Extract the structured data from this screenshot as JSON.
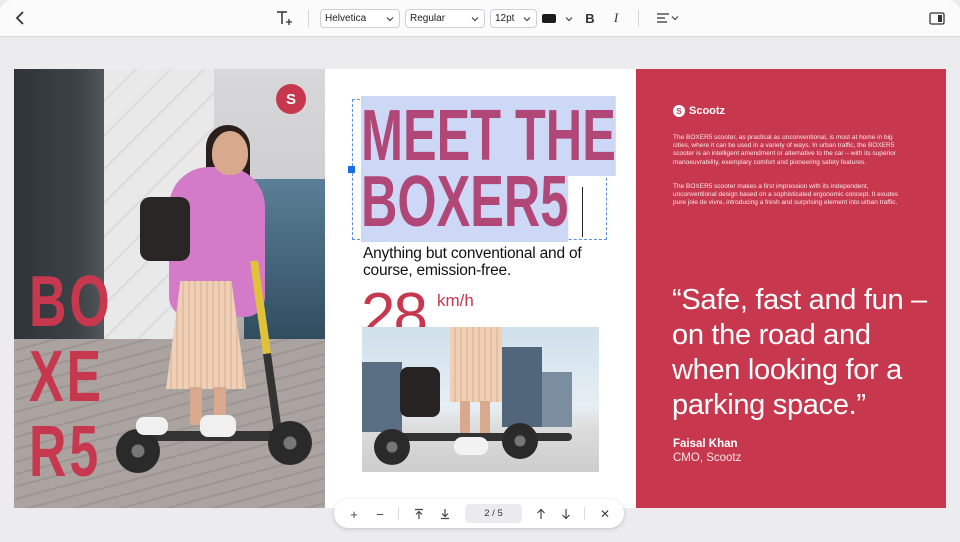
{
  "toolbar": {
    "back_icon": "chevron-left-icon",
    "add_text_icon": "add-text-icon",
    "font_family": "Helvetica",
    "font_weight": "Regular",
    "font_size": "12pt",
    "text_color": "#1b1b1b",
    "bold_label": "B",
    "italic_label": "I",
    "align_icon": "align-left-icon",
    "panel_icon": "sidebar-toggle-icon"
  },
  "document": {
    "left_page": {
      "logo_letter": "S",
      "vertical_title": "BO XE R5"
    },
    "middle_page": {
      "headline_line1": "MEET THE",
      "headline_line2": "BOXER5",
      "subhead": "Anything but conventional and of course, emission-free.",
      "speed_value": "28",
      "speed_unit": "km/h"
    },
    "right_page": {
      "brand_name": "Scootz",
      "paragraph1": "The BOXER5 scooter, as practical as unconventional, is most at home in big cities, where it can be used in a variety of ways. In urban traffic, the BOXER5 scooter is an intelligent amendment or alternative to the car – with its superior manoeuvrability, exemplary comfort and pioneering safety features.",
      "paragraph2": "The BOXER5 scooter makes a first impression with its independent, unconventional design based on a sophisticated ergonomic concept. It exudes pure joie de vivre, introducing a fresh and surprising element into urban traffic.",
      "quote": "“Safe, fast and fun – on the road and when looking for a parking space.”",
      "author_name": "Faisal Khan",
      "author_role": "CMO, Scootz"
    }
  },
  "pager": {
    "zoom_in": "+",
    "zoom_out": "−",
    "page_indicator": "2 / 5",
    "close": "✕"
  },
  "colors": {
    "accent": "#c7384f",
    "headline": "#b04777",
    "selection": "#ccd8f6",
    "handle": "#1a6be6"
  }
}
